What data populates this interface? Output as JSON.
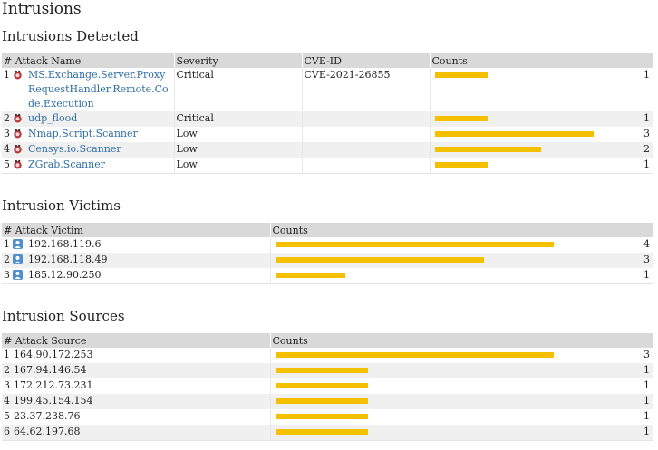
{
  "page_title": "Intrusions",
  "colors": {
    "bar": "#f5c000",
    "link": "#2f6ea8",
    "header_bg": "#d9d9d9",
    "alt_row": "#f0f0f0"
  },
  "detected": {
    "title": "Intrusions Detected",
    "headers": {
      "idx": "#",
      "name": "Attack Name",
      "severity": "Severity",
      "cve": "CVE-ID",
      "counts": "Counts"
    },
    "max_count": 3,
    "rows": [
      {
        "idx": "1",
        "name": "MS.Exchange.Server.ProxyRequestHandler.Remote.Code.Execution",
        "severity": "Critical",
        "cve": "CVE-2021-26855",
        "count": 1,
        "count_label": "1",
        "icon": "bug-icon"
      },
      {
        "idx": "2",
        "name": "udp_flood",
        "severity": "Critical",
        "cve": "",
        "count": 1,
        "count_label": "1",
        "icon": "bug-icon"
      },
      {
        "idx": "3",
        "name": "Nmap.Script.Scanner",
        "severity": "Low",
        "cve": "",
        "count": 3,
        "count_label": "3",
        "icon": "bug-icon"
      },
      {
        "idx": "4",
        "name": "Censys.io.Scanner",
        "severity": "Low",
        "cve": "",
        "count": 2,
        "count_label": "2",
        "icon": "bug-icon"
      },
      {
        "idx": "5",
        "name": "ZGrab.Scanner",
        "severity": "Low",
        "cve": "",
        "count": 1,
        "count_label": "1",
        "icon": "bug-icon"
      }
    ]
  },
  "victims": {
    "title": "Intrusion Victims",
    "headers": {
      "idx": "#",
      "name": "Attack Victim",
      "counts": "Counts"
    },
    "max_count": 4,
    "rows": [
      {
        "idx": "1",
        "name": "192.168.119.6",
        "count": 4,
        "count_label": "4",
        "icon": "user-icon"
      },
      {
        "idx": "2",
        "name": "192.168.118.49",
        "count": 3,
        "count_label": "3",
        "icon": "user-icon"
      },
      {
        "idx": "3",
        "name": "185.12.90.250",
        "count": 1,
        "count_label": "1",
        "icon": "user-icon"
      }
    ]
  },
  "sources": {
    "title": "Intrusion Sources",
    "headers": {
      "idx": "#",
      "name": "Attack Source",
      "counts": "Counts"
    },
    "max_count": 3,
    "rows": [
      {
        "idx": "1",
        "name": "164.90.172.253",
        "count": 3,
        "count_label": "3"
      },
      {
        "idx": "2",
        "name": "167.94.146.54",
        "count": 1,
        "count_label": "1"
      },
      {
        "idx": "3",
        "name": "172.212.73.231",
        "count": 1,
        "count_label": "1"
      },
      {
        "idx": "4",
        "name": "199.45.154.154",
        "count": 1,
        "count_label": "1"
      },
      {
        "idx": "5",
        "name": "23.37.238.76",
        "count": 1,
        "count_label": "1"
      },
      {
        "idx": "6",
        "name": "64.62.197.68",
        "count": 1,
        "count_label": "1"
      }
    ]
  }
}
